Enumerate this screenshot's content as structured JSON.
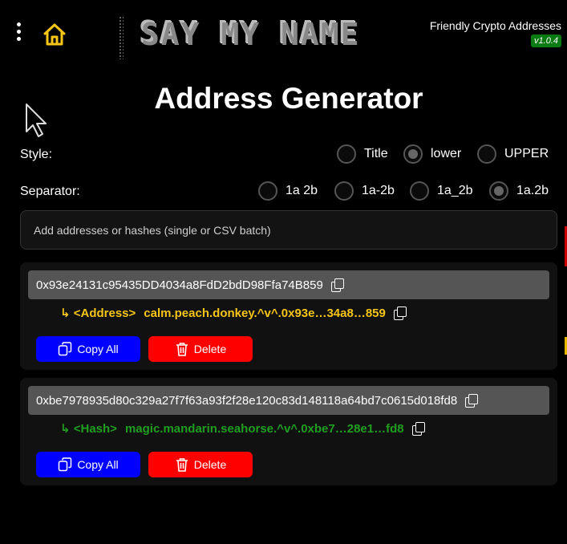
{
  "header": {
    "logo_text": "SAY MY NAME",
    "brand": "Friendly Crypto Addresses",
    "version": "v1.0.4"
  },
  "page_title": "Address Generator",
  "style": {
    "label": "Style:",
    "options": [
      "Title",
      "lower",
      "UPPER"
    ],
    "selected": "lower"
  },
  "separator": {
    "label": "Separator:",
    "options": [
      "1a 2b",
      "1a-2b",
      "1a_2b",
      "1a.2b"
    ],
    "selected": "1a.2b"
  },
  "input": {
    "placeholder": "Add addresses or hashes (single or CSV batch)"
  },
  "cards": [
    {
      "value": "0x93e24131c95435DD4034a8FdD2bdD98Ffa74B859",
      "tag": "↳ <Address>",
      "name": "calm.peach.donkey.^v^.0x93e…34a8…859",
      "color": "#f5c518",
      "copy_label": "Copy All",
      "delete_label": "Delete"
    },
    {
      "value": "0xbe7978935d80c329a27f7f63a93f2f28e120c83d148118a64bd7c0615d018fd8",
      "tag": "↳ <Hash>",
      "name": "magic.mandarin.seahorse.^v^.0xbe7…28e1…fd8",
      "color": "#1f9e1f",
      "copy_label": "Copy All",
      "delete_label": "Delete"
    }
  ]
}
